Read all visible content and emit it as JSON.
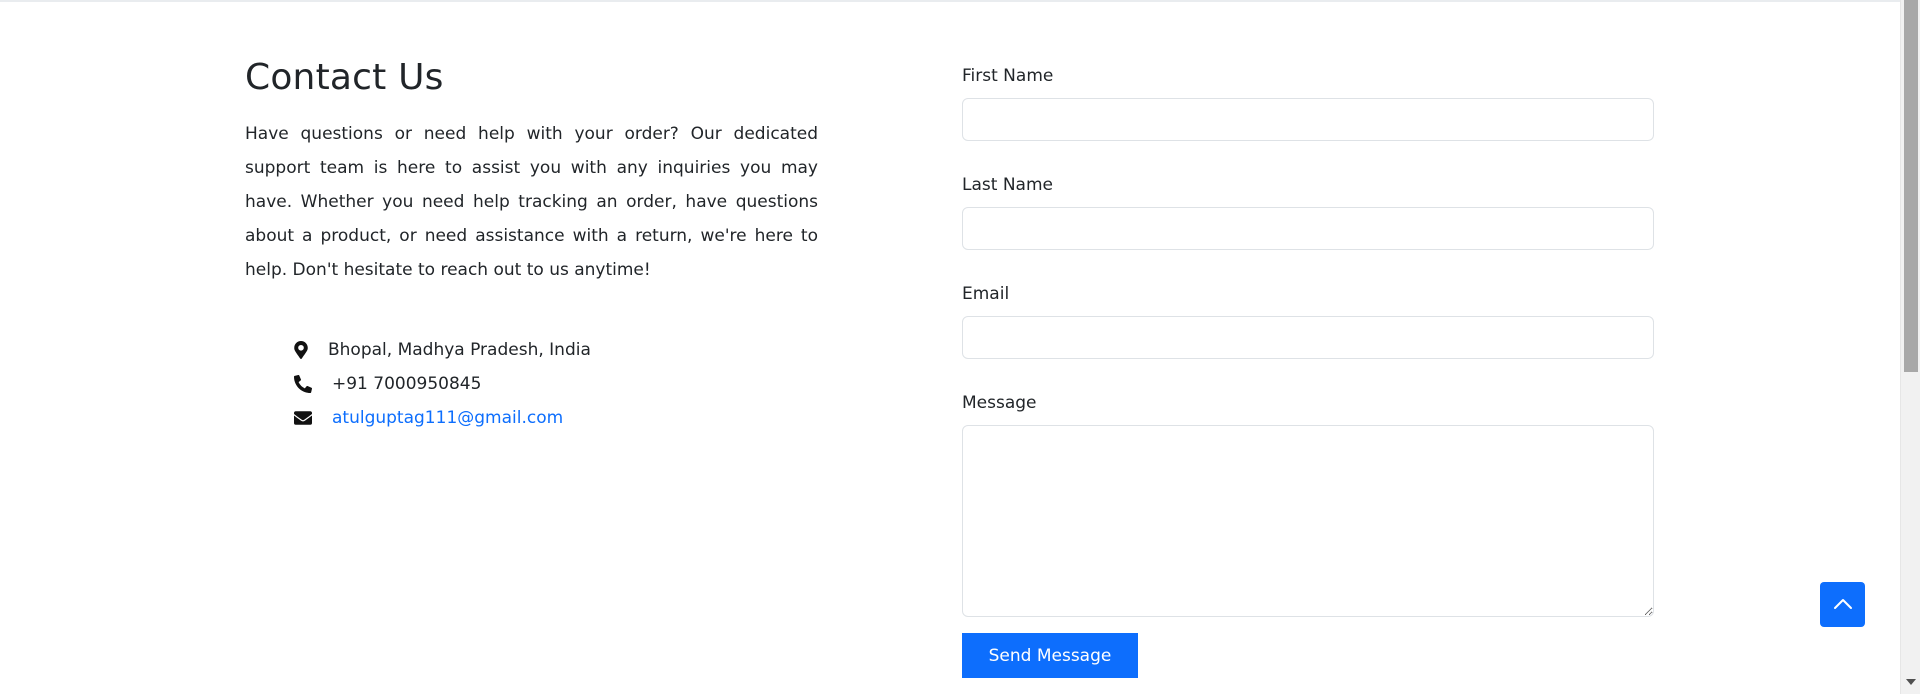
{
  "contact": {
    "title": "Contact Us",
    "description": "Have questions or need help with your order? Our dedicated support team is here to assist you with any inquiries you may have. Whether you need help tracking an order, have questions about a product, or need assistance with a return, we're here to help. Don't hesitate to reach out to us anytime!",
    "address": "Bhopal, Madhya Pradesh, India",
    "phone": "+91 7000950845",
    "email": "atulguptag111@gmail.com",
    "icons": {
      "address": "map-marker-icon",
      "phone": "phone-icon",
      "email": "envelope-icon"
    }
  },
  "form": {
    "first_name_label": "First Name",
    "first_name_value": "",
    "last_name_label": "Last Name",
    "last_name_value": "",
    "email_label": "Email",
    "email_value": "",
    "message_label": "Message",
    "message_value": "",
    "submit_label": "Send Message"
  },
  "back_to_top": {
    "icon": "chevron-up-icon"
  },
  "colors": {
    "primary": "#0d6efd",
    "text": "#212529",
    "border": "#dee2e6"
  }
}
